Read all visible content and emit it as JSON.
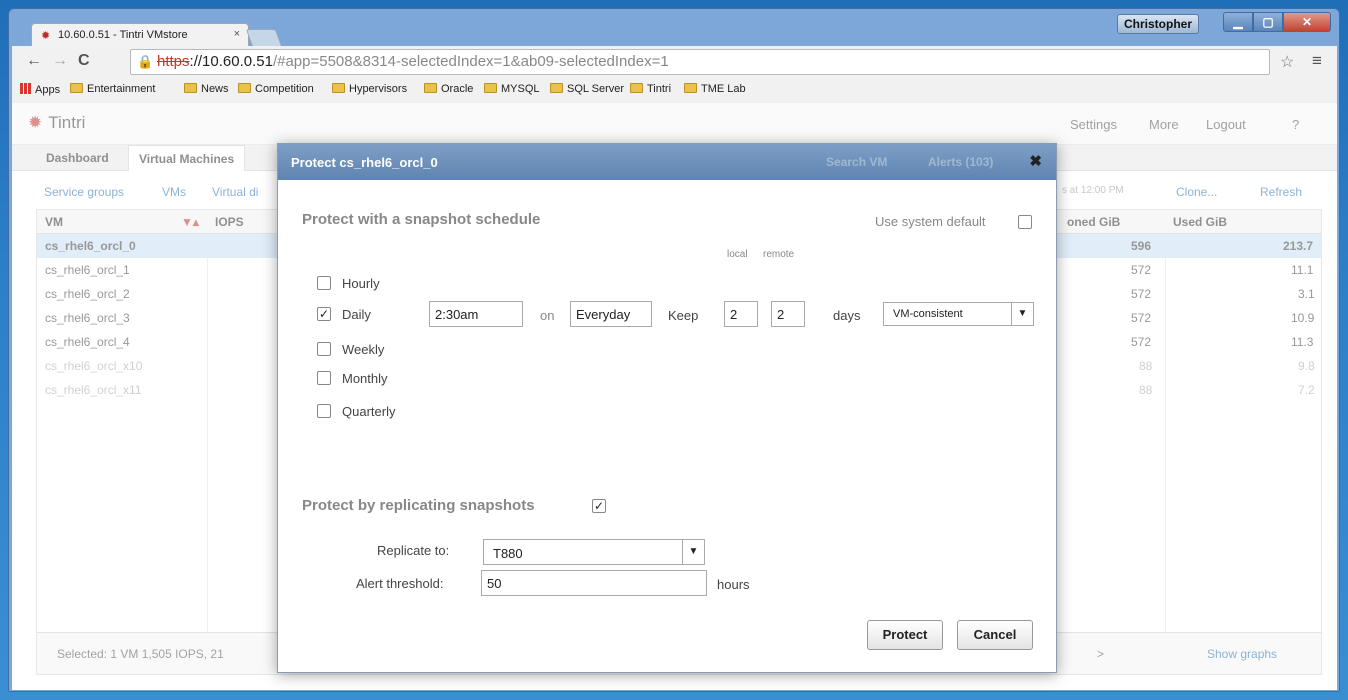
{
  "browser": {
    "tab_title": "10.60.0.51 - Tintri VMstore",
    "tab_close": "×",
    "user": "Christopher",
    "url_proto": "https",
    "url_host": "://10.60.0.51",
    "url_path": "/#app=5508&8314-selectedIndex=1&ab09-selectedIndex=1",
    "bookmarks": [
      "Apps",
      "Entertainment",
      "News",
      "Competition",
      "Hypervisors",
      "Oracle",
      "MYSQL",
      "SQL Server",
      "Tintri",
      "TME Lab"
    ]
  },
  "app": {
    "logo": "Tintri",
    "topnav": [
      "Settings",
      "More",
      "Logout",
      "?"
    ],
    "tabs": [
      "Dashboard",
      "Virtual Machines"
    ],
    "subnav": [
      "Service groups",
      "VMs",
      "Virtual di"
    ],
    "subnav_right": [
      "s at 12:00 PM",
      "Clone...",
      "Refresh"
    ],
    "grid_headers": {
      "vm": "VM",
      "iops": "IOPS",
      "provisioned": "oned GiB",
      "used": "Used GiB"
    },
    "rows": [
      {
        "vm": "cs_rhel6_orcl_0",
        "prov": "596",
        "used": "213.7"
      },
      {
        "vm": "cs_rhel6_orcl_1",
        "prov": "572",
        "used": "11.1"
      },
      {
        "vm": "cs_rhel6_orcl_2",
        "prov": "572",
        "used": "3.1"
      },
      {
        "vm": "cs_rhel6_orcl_3",
        "prov": "572",
        "used": "10.9"
      },
      {
        "vm": "cs_rhel6_orcl_4",
        "prov": "572",
        "used": "11.3"
      },
      {
        "vm": "cs_rhel6_orcl_x10",
        "prov": "88",
        "used": "9.8"
      },
      {
        "vm": "cs_rhel6_orcl_x11",
        "prov": "88",
        "used": "7.2"
      }
    ],
    "footer_left": "Selected: 1 VM 1,505 IOPS, 21",
    "footer_right": "Show graphs"
  },
  "modal": {
    "title": "Protect cs_rhel6_orcl_0",
    "ghost_search": "Search VM",
    "ghost_alerts": "Alerts (103)",
    "schedule_title": "Protect with a snapshot schedule",
    "use_default": "Use system default",
    "col_local": "local",
    "col_remote": "remote",
    "schedules": {
      "hourly": "Hourly",
      "daily": "Daily",
      "weekly": "Weekly",
      "monthly": "Monthly",
      "quarterly": "Quarterly"
    },
    "daily_time": "2:30am",
    "on_label": "on",
    "daily_days": "Everyday",
    "keep_label": "Keep",
    "keep_local": "2",
    "keep_remote": "2",
    "days_label": "days",
    "consistency": "VM-consistent",
    "replicate_title": "Protect by replicating snapshots",
    "replicate_to_label": "Replicate to:",
    "replicate_to": "T880",
    "alert_threshold_label": "Alert threshold:",
    "alert_threshold": "50",
    "hours_label": "hours",
    "protect_button": "Protect",
    "cancel_button": "Cancel"
  }
}
